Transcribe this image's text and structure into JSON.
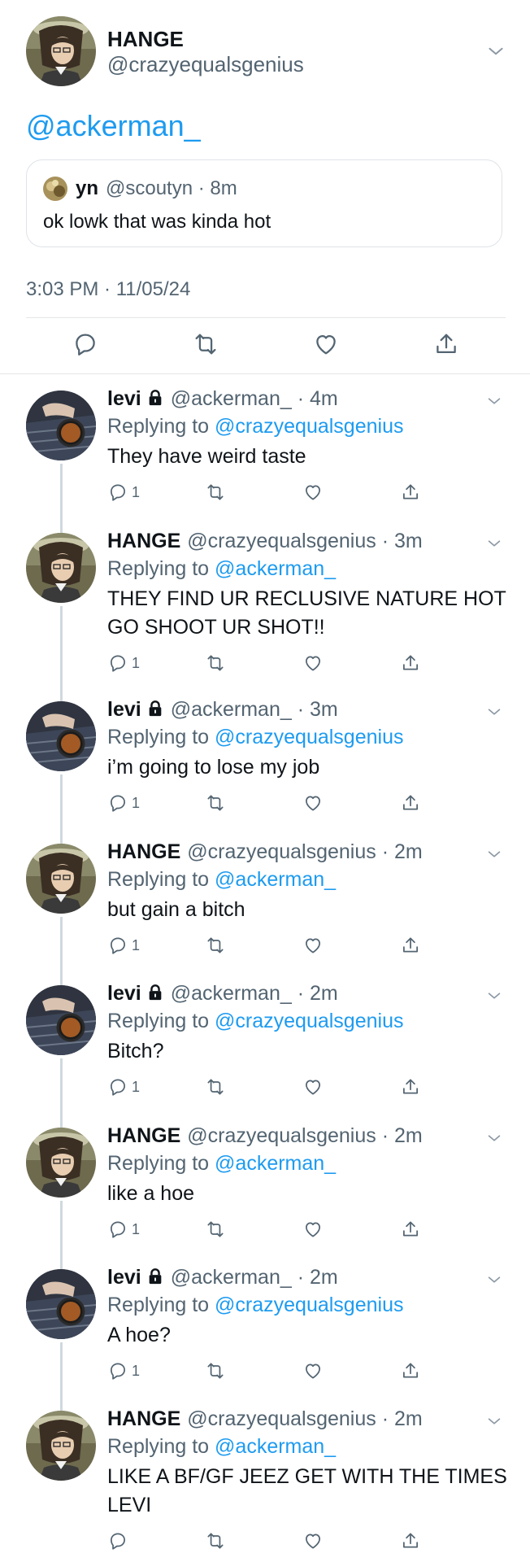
{
  "main_tweet": {
    "name": "HANGE",
    "handle": "@crazyequalsgenius",
    "text": "@ackerman_",
    "quote": {
      "name": "yn",
      "handle_time": "@scoutyn · 8m",
      "text": "ok lowk that was kinda hot"
    },
    "timestamp": "3:03 PM · 11/05/24"
  },
  "replying_prefix": "Replying to",
  "replies": [
    {
      "name": "levi",
      "handle_time": "@ackerman_ · 4m",
      "replying_to": "@crazyequalsgenius",
      "text": "They have weird taste",
      "reply_count": "1"
    },
    {
      "name": "HANGE",
      "handle_time": "@crazyequalsgenius · 3m",
      "replying_to": "@ackerman_",
      "text": "THEY FIND UR RECLUSIVE NATURE HOT GO SHOOT UR SHOT!!",
      "reply_count": "1"
    },
    {
      "name": "levi",
      "handle_time": "@ackerman_ · 3m",
      "replying_to": "@crazyequalsgenius",
      "text": "i’m going to lose my job",
      "reply_count": "1"
    },
    {
      "name": "HANGE",
      "handle_time": "@crazyequalsgenius · 2m",
      "replying_to": "@ackerman_",
      "text": "but gain a bitch",
      "reply_count": "1"
    },
    {
      "name": "levi",
      "handle_time": "@ackerman_ · 2m",
      "replying_to": "@crazyequalsgenius",
      "text": "Bitch?",
      "reply_count": "1"
    },
    {
      "name": "HANGE",
      "handle_time": "@crazyequalsgenius · 2m",
      "replying_to": "@ackerman_",
      "text": "like a hoe",
      "reply_count": "1"
    },
    {
      "name": "levi",
      "handle_time": "@ackerman_ · 2m",
      "replying_to": "@crazyequalsgenius",
      "text": "A hoe?",
      "reply_count": "1"
    },
    {
      "name": "HANGE",
      "handle_time": "@crazyequalsgenius · 2m",
      "replying_to": "@ackerman_",
      "text": "LIKE A BF/GF JEEZ GET WITH THE TIMES LEVI",
      "reply_count": ""
    }
  ],
  "colors": {
    "link": "#1d9bf0",
    "secondary_text": "#536471",
    "thread_line": "#cfd9de"
  }
}
